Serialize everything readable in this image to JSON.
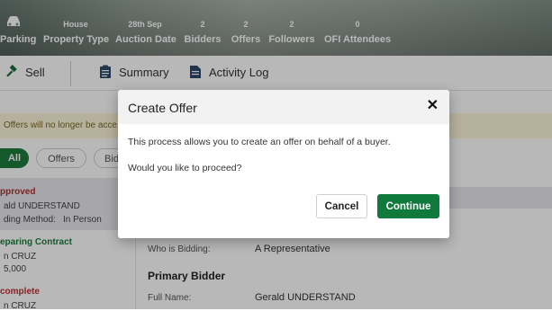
{
  "header": {
    "stats": [
      {
        "value": "",
        "label": "Parking"
      },
      {
        "value": "House",
        "label": "Property Type"
      },
      {
        "value": "28th Sep",
        "label": "Auction Date"
      },
      {
        "value": "2",
        "label": "Bidders"
      },
      {
        "value": "2",
        "label": "Offers"
      },
      {
        "value": "2",
        "label": "Followers"
      },
      {
        "value": "0",
        "label": "OFI Attendees"
      }
    ]
  },
  "tabs": [
    {
      "label": "Sell",
      "icon": "gavel-icon"
    },
    {
      "label": "Summary",
      "icon": "clipboard-icon"
    },
    {
      "label": "Activity Log",
      "icon": "document-icon"
    }
  ],
  "banner": {
    "text": "Offers will no longer be acce"
  },
  "filters": [
    {
      "label": "All",
      "active": true
    },
    {
      "label": "Offers",
      "active": false
    },
    {
      "label": "Bid",
      "active": false
    }
  ],
  "offers_list": [
    {
      "status": "pproved",
      "line1": "ald UNDERSTAND",
      "line2_label": "ding Method:",
      "line2_value": "In Person",
      "status_color": "#b03030"
    },
    {
      "status": "eparing Contract",
      "line1": "n CRUZ",
      "line2_label": "5,000",
      "line2_value": "",
      "status_color": "#1d7a3d"
    },
    {
      "status": "complete",
      "line1": "n CRUZ",
      "line2_label": "",
      "line2_value": "",
      "status_color": "#c03030"
    }
  ],
  "detail": {
    "who_label": "Who is Bidding:",
    "who_value": "A Representative",
    "section_title": "Primary Bidder",
    "full_name_label": "Full Name:",
    "full_name_value": "Gerald UNDERSTAND"
  },
  "modal": {
    "title": "Create Offer",
    "close_glyph": "✕",
    "text1": "This process allows you to create an offer on behalf of a buyer.",
    "text2": "Would you like to proceed?",
    "cancel_label": "Cancel",
    "continue_label": "Continue"
  },
  "colors": {
    "primary": "#0f7a3b",
    "banner": "#fdf6d8"
  }
}
